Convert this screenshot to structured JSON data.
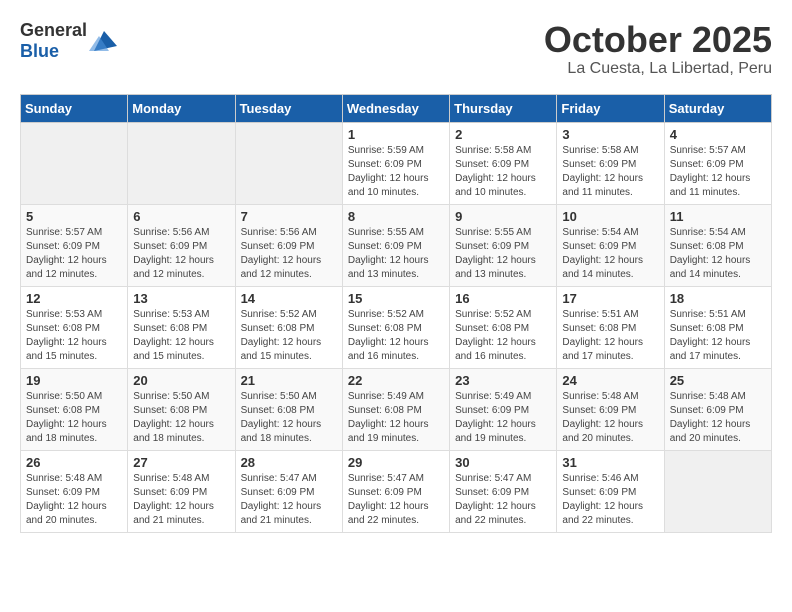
{
  "header": {
    "logo_general": "General",
    "logo_blue": "Blue",
    "month_title": "October 2025",
    "location": "La Cuesta, La Libertad, Peru"
  },
  "weekdays": [
    "Sunday",
    "Monday",
    "Tuesday",
    "Wednesday",
    "Thursday",
    "Friday",
    "Saturday"
  ],
  "weeks": [
    [
      {
        "day": "",
        "info": ""
      },
      {
        "day": "",
        "info": ""
      },
      {
        "day": "",
        "info": ""
      },
      {
        "day": "1",
        "info": "Sunrise: 5:59 AM\nSunset: 6:09 PM\nDaylight: 12 hours\nand 10 minutes."
      },
      {
        "day": "2",
        "info": "Sunrise: 5:58 AM\nSunset: 6:09 PM\nDaylight: 12 hours\nand 10 minutes."
      },
      {
        "day": "3",
        "info": "Sunrise: 5:58 AM\nSunset: 6:09 PM\nDaylight: 12 hours\nand 11 minutes."
      },
      {
        "day": "4",
        "info": "Sunrise: 5:57 AM\nSunset: 6:09 PM\nDaylight: 12 hours\nand 11 minutes."
      }
    ],
    [
      {
        "day": "5",
        "info": "Sunrise: 5:57 AM\nSunset: 6:09 PM\nDaylight: 12 hours\nand 12 minutes."
      },
      {
        "day": "6",
        "info": "Sunrise: 5:56 AM\nSunset: 6:09 PM\nDaylight: 12 hours\nand 12 minutes."
      },
      {
        "day": "7",
        "info": "Sunrise: 5:56 AM\nSunset: 6:09 PM\nDaylight: 12 hours\nand 12 minutes."
      },
      {
        "day": "8",
        "info": "Sunrise: 5:55 AM\nSunset: 6:09 PM\nDaylight: 12 hours\nand 13 minutes."
      },
      {
        "day": "9",
        "info": "Sunrise: 5:55 AM\nSunset: 6:09 PM\nDaylight: 12 hours\nand 13 minutes."
      },
      {
        "day": "10",
        "info": "Sunrise: 5:54 AM\nSunset: 6:09 PM\nDaylight: 12 hours\nand 14 minutes."
      },
      {
        "day": "11",
        "info": "Sunrise: 5:54 AM\nSunset: 6:08 PM\nDaylight: 12 hours\nand 14 minutes."
      }
    ],
    [
      {
        "day": "12",
        "info": "Sunrise: 5:53 AM\nSunset: 6:08 PM\nDaylight: 12 hours\nand 15 minutes."
      },
      {
        "day": "13",
        "info": "Sunrise: 5:53 AM\nSunset: 6:08 PM\nDaylight: 12 hours\nand 15 minutes."
      },
      {
        "day": "14",
        "info": "Sunrise: 5:52 AM\nSunset: 6:08 PM\nDaylight: 12 hours\nand 15 minutes."
      },
      {
        "day": "15",
        "info": "Sunrise: 5:52 AM\nSunset: 6:08 PM\nDaylight: 12 hours\nand 16 minutes."
      },
      {
        "day": "16",
        "info": "Sunrise: 5:52 AM\nSunset: 6:08 PM\nDaylight: 12 hours\nand 16 minutes."
      },
      {
        "day": "17",
        "info": "Sunrise: 5:51 AM\nSunset: 6:08 PM\nDaylight: 12 hours\nand 17 minutes."
      },
      {
        "day": "18",
        "info": "Sunrise: 5:51 AM\nSunset: 6:08 PM\nDaylight: 12 hours\nand 17 minutes."
      }
    ],
    [
      {
        "day": "19",
        "info": "Sunrise: 5:50 AM\nSunset: 6:08 PM\nDaylight: 12 hours\nand 18 minutes."
      },
      {
        "day": "20",
        "info": "Sunrise: 5:50 AM\nSunset: 6:08 PM\nDaylight: 12 hours\nand 18 minutes."
      },
      {
        "day": "21",
        "info": "Sunrise: 5:50 AM\nSunset: 6:08 PM\nDaylight: 12 hours\nand 18 minutes."
      },
      {
        "day": "22",
        "info": "Sunrise: 5:49 AM\nSunset: 6:08 PM\nDaylight: 12 hours\nand 19 minutes."
      },
      {
        "day": "23",
        "info": "Sunrise: 5:49 AM\nSunset: 6:09 PM\nDaylight: 12 hours\nand 19 minutes."
      },
      {
        "day": "24",
        "info": "Sunrise: 5:48 AM\nSunset: 6:09 PM\nDaylight: 12 hours\nand 20 minutes."
      },
      {
        "day": "25",
        "info": "Sunrise: 5:48 AM\nSunset: 6:09 PM\nDaylight: 12 hours\nand 20 minutes."
      }
    ],
    [
      {
        "day": "26",
        "info": "Sunrise: 5:48 AM\nSunset: 6:09 PM\nDaylight: 12 hours\nand 20 minutes."
      },
      {
        "day": "27",
        "info": "Sunrise: 5:48 AM\nSunset: 6:09 PM\nDaylight: 12 hours\nand 21 minutes."
      },
      {
        "day": "28",
        "info": "Sunrise: 5:47 AM\nSunset: 6:09 PM\nDaylight: 12 hours\nand 21 minutes."
      },
      {
        "day": "29",
        "info": "Sunrise: 5:47 AM\nSunset: 6:09 PM\nDaylight: 12 hours\nand 22 minutes."
      },
      {
        "day": "30",
        "info": "Sunrise: 5:47 AM\nSunset: 6:09 PM\nDaylight: 12 hours\nand 22 minutes."
      },
      {
        "day": "31",
        "info": "Sunrise: 5:46 AM\nSunset: 6:09 PM\nDaylight: 12 hours\nand 22 minutes."
      },
      {
        "day": "",
        "info": ""
      }
    ]
  ]
}
